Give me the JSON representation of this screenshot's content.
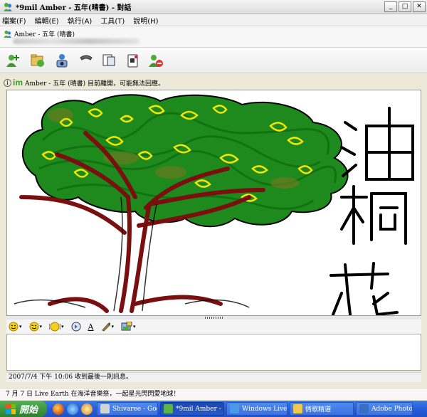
{
  "window": {
    "title": "*9mil Amber - 五年(晴書) - 對話"
  },
  "menu": [
    {
      "label": "檔案(F)"
    },
    {
      "label": "編輯(E)"
    },
    {
      "label": "執行(A)"
    },
    {
      "label": "工具(T)"
    },
    {
      "label": "說明(H)"
    }
  ],
  "contact": {
    "name": "Amber - 五年 (晴書)"
  },
  "toolbar": {
    "icons": [
      "invite-contact-icon",
      "send-files-icon",
      "video-call-icon",
      "call-icon",
      "activities-icon",
      "games-icon",
      "block-icon"
    ]
  },
  "notice": {
    "logo": "im",
    "text": "Amber - 五年 (晴書) 目前離開，可能無法回應。"
  },
  "drawing": {
    "handwritten_text": "油桐花",
    "colors": {
      "trunk": "#7a0f0f",
      "leaves": "#1e8a1e",
      "flowers": "#f2e600",
      "outline": "#000000"
    }
  },
  "format_bar": {
    "icons": [
      "emoticon-icon",
      "wink-icon",
      "voice-clip-icon",
      "nudge-icon",
      "font-icon",
      "ink-icon",
      "background-icon"
    ],
    "font_label": "A"
  },
  "last_message": "2007/7/4 下午 10:06 收到最後一則訊息。",
  "ticker": "7 月 7 日 Live Earth 在海洋音樂祭，一起星光閃閃愛地球！",
  "taskbar": {
    "start_label": "開始",
    "tasks": [
      {
        "label": "Shivaree - Goo...",
        "active": false,
        "color": "#d4d4d4"
      },
      {
        "label": "*9mil Amber - ...",
        "active": true,
        "color": "#5fb24a"
      },
      {
        "label": "Windows Live ...",
        "active": false,
        "color": "#4a9ae8"
      },
      {
        "label": "情歌精選",
        "active": false,
        "color": "#f0c850"
      },
      {
        "label": "Adobe Photosh...",
        "active": false,
        "color": "#3a6ec0"
      }
    ]
  }
}
